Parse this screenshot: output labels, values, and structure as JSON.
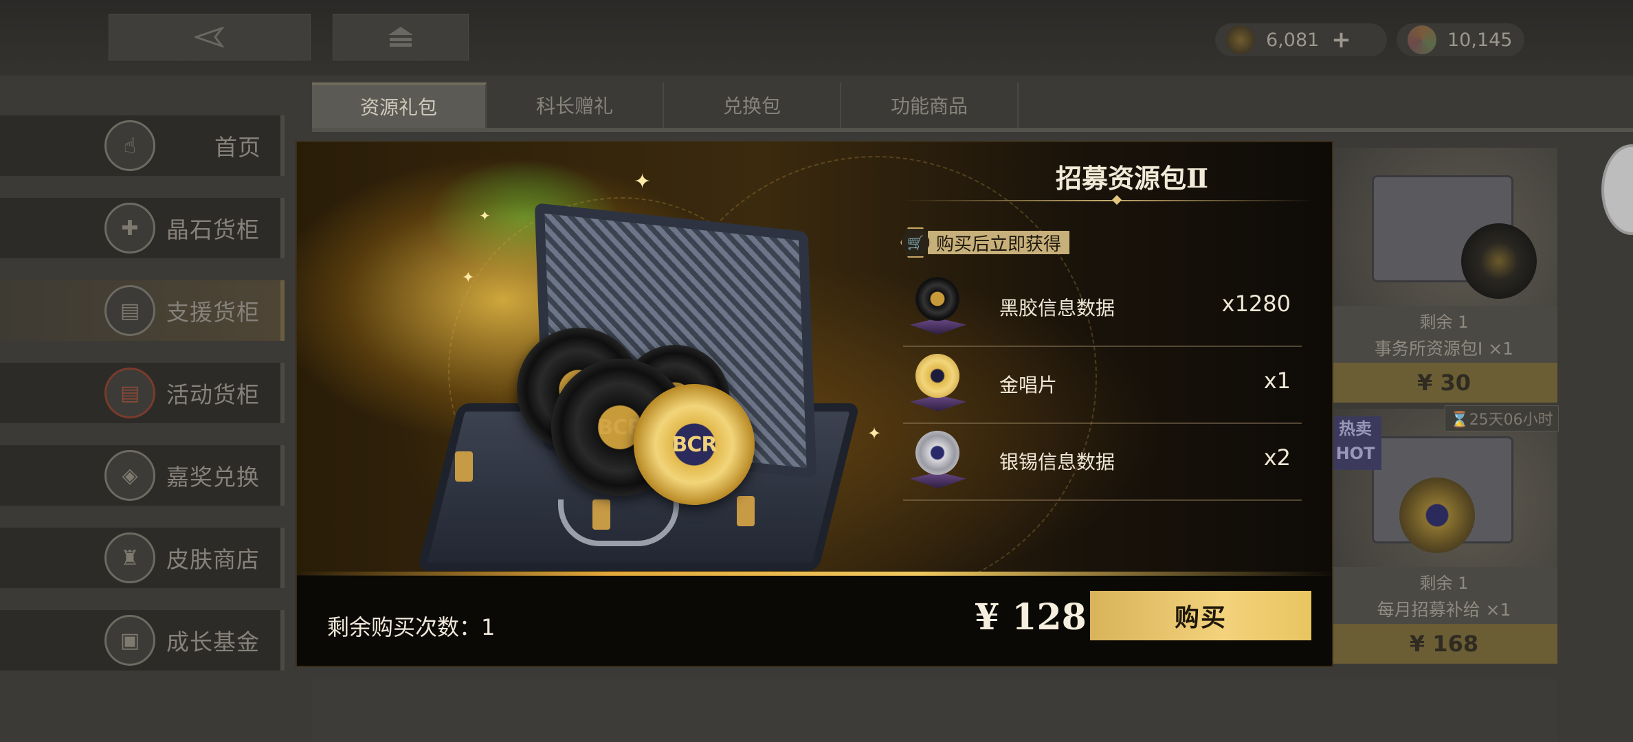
{
  "topbar": {
    "back_icon": "back-arrow-icon",
    "home_icon": "home-icon",
    "currency1": {
      "icon": "bullet-coin-icon",
      "value": "6,081",
      "plus": "+"
    },
    "currency2": {
      "icon": "crystal-icon",
      "value": "10,145"
    }
  },
  "tabs": [
    {
      "label": "资源礼包",
      "active": true
    },
    {
      "label": "科长赠礼",
      "active": false
    },
    {
      "label": "兑换包",
      "active": false
    },
    {
      "label": "功能商品",
      "active": false
    }
  ],
  "sidebar": {
    "items": [
      {
        "label": "首页",
        "icon": "hand-pointer-icon"
      },
      {
        "label": "晶石货柜",
        "icon": "crystal-cross-icon"
      },
      {
        "label": "支援货柜",
        "icon": "crate-icon",
        "active": true
      },
      {
        "label": "活动货柜",
        "icon": "event-crate-icon"
      },
      {
        "label": "嘉奖兑换",
        "icon": "badge-icon"
      },
      {
        "label": "皮肤商店",
        "icon": "jacket-icon"
      },
      {
        "label": "成长基金",
        "icon": "fund-box-icon"
      }
    ]
  },
  "right_cards": [
    {
      "remain": "剩余 1",
      "name": "事务所资源包Ⅰ ×1",
      "price": "¥ 30"
    },
    {
      "remain": "剩余 1",
      "name": "每月招募补给 ×1",
      "price": "¥ 168",
      "badge": "热卖 HOT",
      "timer": "⌛25天06小时"
    }
  ],
  "modal": {
    "title": "招募资源包Ⅱ",
    "gain_tag": "购买后立即获得",
    "items": [
      {
        "name": "黑胶信息数据",
        "qty": "x1280",
        "icon": "black-vinyl-icon"
      },
      {
        "name": "金唱片",
        "qty": "x1",
        "icon": "gold-record-icon"
      },
      {
        "name": "银锡信息数据",
        "qty": "x2",
        "icon": "silver-disc-icon"
      }
    ],
    "disc_logo": "BCR",
    "remain_label": "剩余购买次数：1",
    "price": "¥ 128",
    "buy_label": "购买"
  },
  "colors": {
    "accent_gold": "#f2d27c",
    "modal_bg": "#120f0b",
    "vinyl_purple": "#6a4a86"
  }
}
